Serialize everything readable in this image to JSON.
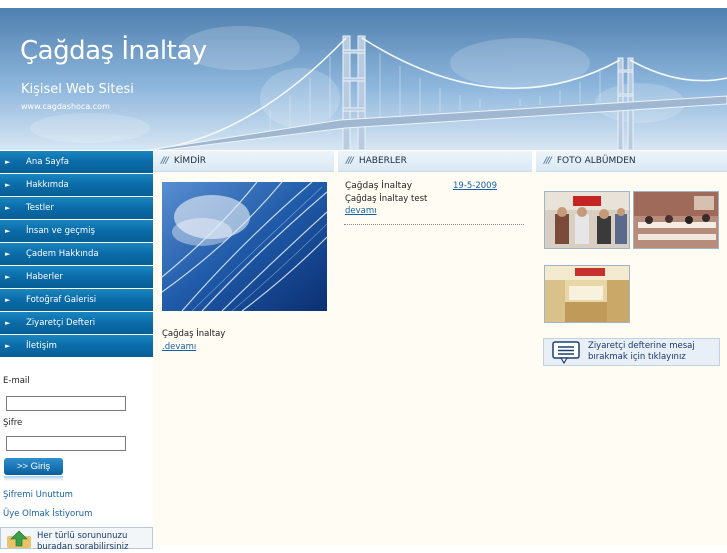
{
  "header": {
    "title": "Çağdaş İnaltay",
    "subtitle": "Kişisel Web Sitesi",
    "url": "www.cagdashoca.com"
  },
  "nav": {
    "items": [
      {
        "label": "Ana Sayfa"
      },
      {
        "label": "Hakkımda"
      },
      {
        "label": "Testler"
      },
      {
        "label": "İnsan ve geçmiş"
      },
      {
        "label": "Çadem Hakkında"
      },
      {
        "label": "Haberler"
      },
      {
        "label": "Fotoğraf Galerisi"
      },
      {
        "label": "Ziyaretçi Defteri"
      },
      {
        "label": "İletişim"
      }
    ],
    "arrow": "►"
  },
  "login": {
    "email_label": "E-mail",
    "password_label": "Şifre",
    "button_label": ">> Giriş",
    "forgot_label": "Şifremi Unuttum",
    "register_label": "Üye Olmak İstiyorum"
  },
  "help": {
    "text": "Her türlü sorununuzu buradan sorabilirsiniz"
  },
  "kimdir": {
    "heading": "KİMDİR",
    "name": "Çağdaş İnaltay",
    "more_link": ".devamı"
  },
  "haberler": {
    "heading": "HABERLER",
    "items": [
      {
        "title": "Çağdaş İnaltay",
        "date": "19-5-2009",
        "summary": "Çağdaş İnaltay test",
        "more_link": "devamı"
      }
    ]
  },
  "album": {
    "heading": "FOTO ALBÜMDEN",
    "guestbook_text": "Ziyaretçi defterine mesaj bırakmak için tıklayınız"
  },
  "colors": {
    "nav_bg": "#0a6ba8",
    "link": "#1560a8",
    "content_bg": "#fefcf3"
  }
}
